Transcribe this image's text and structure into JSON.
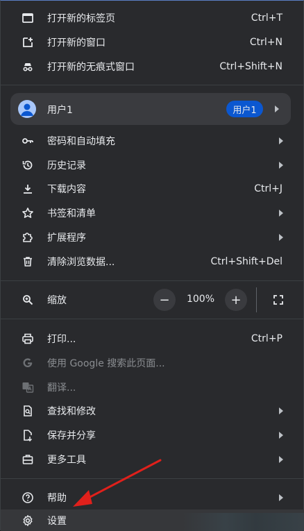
{
  "menu": {
    "new_tab": {
      "label": "打开新的标签页",
      "shortcut": "Ctrl+T",
      "icon": "new-tab-icon"
    },
    "new_window": {
      "label": "打开新的窗口",
      "shortcut": "Ctrl+N",
      "icon": "new-window-icon"
    },
    "incognito": {
      "label": "打开新的无痕式窗口",
      "shortcut": "Ctrl+Shift+N",
      "icon": "incognito-icon"
    },
    "profile": {
      "label": "用户1",
      "badge": "用户1"
    },
    "passwords": {
      "label": "密码和自动填充",
      "icon": "key-icon"
    },
    "history": {
      "label": "历史记录",
      "icon": "history-icon"
    },
    "downloads": {
      "label": "下载内容",
      "shortcut": "Ctrl+J",
      "icon": "download-icon"
    },
    "bookmarks": {
      "label": "书签和清单",
      "icon": "star-icon"
    },
    "extensions": {
      "label": "扩展程序",
      "icon": "puzzle-icon"
    },
    "clear_data": {
      "label": "清除浏览数据...",
      "shortcut": "Ctrl+Shift+Del",
      "icon": "trash-icon"
    },
    "zoom": {
      "label": "缩放",
      "value": "100%",
      "minus": "−",
      "plus": "+",
      "icon": "zoom-icon"
    },
    "print": {
      "label": "打印...",
      "shortcut": "Ctrl+P",
      "icon": "print-icon"
    },
    "google_search": {
      "label": "使用 Google 搜索此页面...",
      "icon": "google-icon"
    },
    "translate": {
      "label": "翻译...",
      "icon": "translate-icon"
    },
    "find_edit": {
      "label": "查找和修改",
      "icon": "find-icon"
    },
    "save_share": {
      "label": "保存并分享",
      "icon": "share-icon"
    },
    "more_tools": {
      "label": "更多工具",
      "icon": "toolbox-icon"
    },
    "help": {
      "label": "帮助",
      "icon": "help-icon"
    },
    "settings": {
      "label": "设置",
      "icon": "gear-icon"
    }
  },
  "colors": {
    "background": "#292a2d",
    "text": "#e8eaed",
    "dim_text": "#8a8d91",
    "badge": "#0b57d0",
    "arrow_annotation": "#e0201b"
  }
}
